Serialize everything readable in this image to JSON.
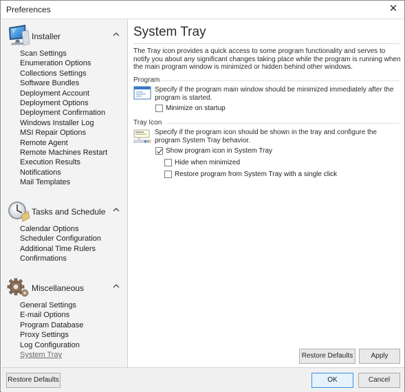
{
  "window": {
    "title": "Preferences",
    "close_glyph": "✕"
  },
  "sidebar": {
    "sections": [
      {
        "title": "Installer",
        "icon": "computer-monitor-icon",
        "items": [
          "Scan Settings",
          "Enumeration Options",
          "Collections Settings",
          "Software Bundles",
          "Deployment Account",
          "Deployment Options",
          "Deployment Confirmation",
          "Windows Installer Log",
          "MSI Repair Options",
          "Remote Agent",
          "Remote Machines Restart",
          "Execution Results",
          "Notifications",
          "Mail Templates"
        ]
      },
      {
        "title": "Tasks and Schedule",
        "icon": "clock-icon",
        "items": [
          "Calendar Options",
          "Scheduler Configuration",
          "Additional Time Rulers",
          "Confirmations"
        ]
      },
      {
        "title": "Miscellaneous",
        "icon": "gears-icon",
        "items": [
          "General Settings",
          "E-mail Options",
          "Program Database",
          "Proxy Settings",
          "Log Configuration",
          "System Tray"
        ]
      }
    ],
    "active_item": "System Tray"
  },
  "content": {
    "title": "System Tray",
    "intro": "The Tray icon provides a quick access to some program functionality and serves to notify you about any significant changes taking place while the program is running when the main program window is minimized or hidden behind other windows.",
    "program_group": {
      "label": "Program",
      "description": "Specify if the program main window should be minimized immediately after the program is started.",
      "options": [
        {
          "label": "Minimize on startup",
          "checked": false
        }
      ]
    },
    "tray_group": {
      "label": "Tray Icon",
      "description": "Specify if the program icon should be shown in the tray and configure the program System Tray behavior.",
      "options": [
        {
          "label": "Show program icon in System Tray",
          "checked": true
        },
        {
          "label": "Hide when minimized",
          "checked": false
        },
        {
          "label": "Restore program from System Tray with a single click",
          "checked": false
        }
      ]
    },
    "restore_defaults_label": "Restore Defaults",
    "apply_label": "Apply"
  },
  "footer": {
    "restore_defaults_label": "Restore Defaults",
    "ok_label": "OK",
    "cancel_label": "Cancel"
  },
  "colors": {
    "sidebar_bg": "#f3f3f3",
    "accent_border": "#3a8ee6"
  }
}
